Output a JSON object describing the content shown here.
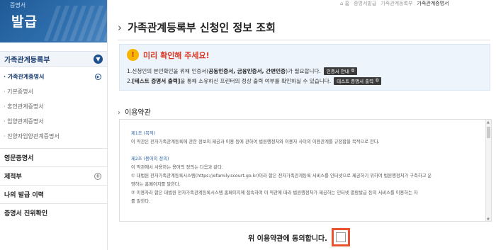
{
  "logo": {
    "small_text": "증명서",
    "big_text": "발급"
  },
  "breadcrumb": {
    "home": "⌂ 홈",
    "items": [
      "증명서발급",
      "가족관계등록부"
    ],
    "current": "가족관계증명서"
  },
  "sidebar": {
    "head": "가족관계등록부",
    "sub_items": [
      {
        "label": "· 가족관계증명서",
        "active": true
      },
      {
        "label": "· 기본증명서",
        "active": false
      },
      {
        "label": "· 혼인관계증명서",
        "active": false
      },
      {
        "label": "· 입양관계증명서",
        "active": false
      },
      {
        "label": "· 친양자입양관계증명서",
        "active": false
      }
    ],
    "main_items": [
      "영문증명서",
      "제적부",
      "나의 발급 이력",
      "증명서 진위확인"
    ]
  },
  "page_title": "가족관계등록부 신청인 정보 조회",
  "notice": {
    "heading": "미리 확인해 주세요!",
    "line1_pre": "1.신청인의 본인확인을 위해 인증서(",
    "line1_bold": "공동인증서, 금융인증서, 간편인증",
    "line1_post": ")가 필요합니다.",
    "line1_button": "인증서 안내",
    "line2_pre": "2.",
    "line2_bold": "[테스트 증명서 출력]",
    "line2_post": "을 통해 소유하신 프린터의 정상 출력 여부를 확인하실 수 있습니다.",
    "line2_button": "테스트 증명서 출력"
  },
  "terms_section_title": "이용약관",
  "terms": {
    "art1_title": "제1조 (목적)",
    "art1_text": "이 약관은 전자가족관계등록에 관한 정보의 제공과 이용 등에 관하여 법원행정처와 이용자 사이의 이용관계를 규정함을 목적으로 한다.",
    "art2_title": "제2조 (용어의 정의)",
    "art2_intro": "이 약관에서 사용하는 용어의 정의는 다음과 같다.",
    "art2_item1": "① 대법원 전자가족관계등록시스템(https://efamily.scourt.go.kr)이라 함은 전자가족관계등록 서비스를 인터넷으로 제공하기 위하여 법원행정처가 구축하고 운",
    "art2_item1b": "영하는 홈페이지를 말한다.",
    "art2_item2": "② 이용자라 함은 대법원 전자가족관계등록시스템 홈페이지에 접속하여 이 약관에 따라 법원행정처가 제공하는 인터넷 열람발급 등의 서비스를 이용하는 자",
    "art2_item2b": "를 말한다."
  },
  "agree_label": "위 이용약관에 동의합니다."
}
